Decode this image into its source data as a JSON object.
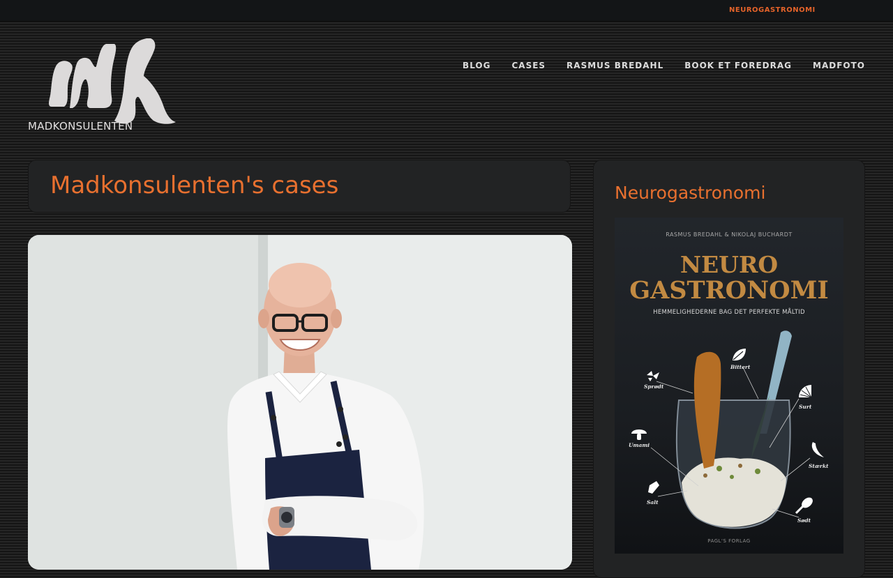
{
  "topbar": {
    "link": "NEUROGASTRONOMI"
  },
  "logo": {
    "text": "MADKONSULENTEN"
  },
  "nav": [
    {
      "label": "BLOG"
    },
    {
      "label": "CASES"
    },
    {
      "label": "RASMUS BREDAHL"
    },
    {
      "label": "BOOK ET FOREDRAG"
    },
    {
      "label": "MADFOTO"
    }
  ],
  "page": {
    "title": "Madkonsulenten's cases"
  },
  "sidebar": {
    "title": "Neurogastronomi",
    "book": {
      "authors": "RASMUS BREDAHL & NIKOLAJ BUCHARDT",
      "title_line1": "NEURO",
      "title_line2": "GASTRONOMI",
      "subtitle": "HEMMELIGHEDERNE BAG DET PERFEKTE MÅLTID",
      "tastes": [
        "Sprødt",
        "Bittert",
        "Surt",
        "Umami",
        "Stærkt",
        "Salt",
        "Sødt"
      ],
      "publisher": "PAGL'S FORLAG"
    }
  },
  "colors": {
    "accent": "#e8702f",
    "nav_text": "#dcdcdc",
    "panel": "#222324",
    "book_title": "#c28a42"
  },
  "icons": [
    "logo-mark-icon",
    "leaf-icon",
    "lemon-icon",
    "chili-icon",
    "mushroom-icon",
    "salt-shaker-icon",
    "honey-dipper-icon",
    "cracker-icon"
  ]
}
